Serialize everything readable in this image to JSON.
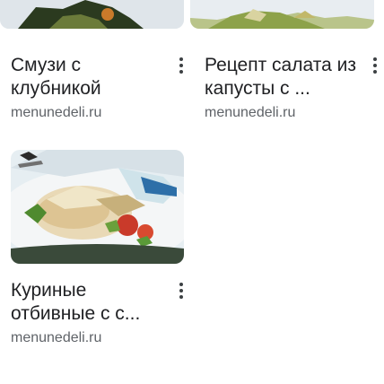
{
  "results": [
    {
      "title": "Смузи с клубникой",
      "source": "menunedeli.ru",
      "image": "strawberry-smoothie-photo"
    },
    {
      "title": "Рецепт салата из капусты с ...",
      "source": "menunedeli.ru",
      "image": "cabbage-salad-photo"
    },
    {
      "title": "Куриные отбивные с с...",
      "source": "menunedeli.ru",
      "image": "chicken-cutlets-photo"
    }
  ],
  "more_icon": "more-vert-icon"
}
